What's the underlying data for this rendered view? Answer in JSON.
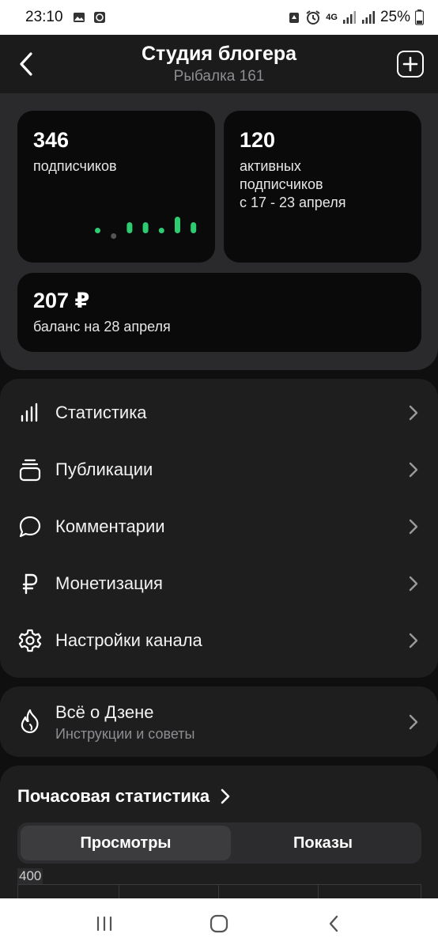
{
  "status_bar": {
    "time": "23:10",
    "battery": "25%",
    "network": "4G"
  },
  "header": {
    "title": "Студия блогера",
    "subtitle": "Рыбалка 161"
  },
  "cards": {
    "subscribers": {
      "value": "346",
      "label": "подписчиков"
    },
    "active": {
      "value": "120",
      "label_line1": "активных",
      "label_line2": "подписчиков",
      "label_line3": "с 17 - 23 апреля"
    },
    "balance": {
      "value": "207 ₽",
      "label": "баланс на 28 апреля"
    }
  },
  "sparkline": {
    "accent": "#2ecc71",
    "negative_color": "#555555",
    "values": [
      1,
      -1,
      2,
      2,
      1,
      3,
      2
    ]
  },
  "menu": {
    "items": [
      {
        "label": "Статистика",
        "icon": "bar-chart-icon"
      },
      {
        "label": "Публикации",
        "icon": "stack-icon"
      },
      {
        "label": "Комментарии",
        "icon": "comment-icon"
      },
      {
        "label": "Монетизация",
        "icon": "ruble-icon"
      },
      {
        "label": "Настройки канала",
        "icon": "gear-icon"
      }
    ]
  },
  "about": {
    "title": "Всё о Дзене",
    "subtitle": "Инструкции и советы",
    "icon": "flame-icon"
  },
  "hourly": {
    "title": "Почасовая статистика",
    "tabs": [
      "Просмотры",
      "Показы"
    ],
    "selected_tab": "Просмотры",
    "axis_top": "400"
  },
  "colors": {
    "background": "#0f0f10",
    "card": "#0a0a0a",
    "panel": "#2a2a2c",
    "accent_green": "#2ecc71"
  }
}
